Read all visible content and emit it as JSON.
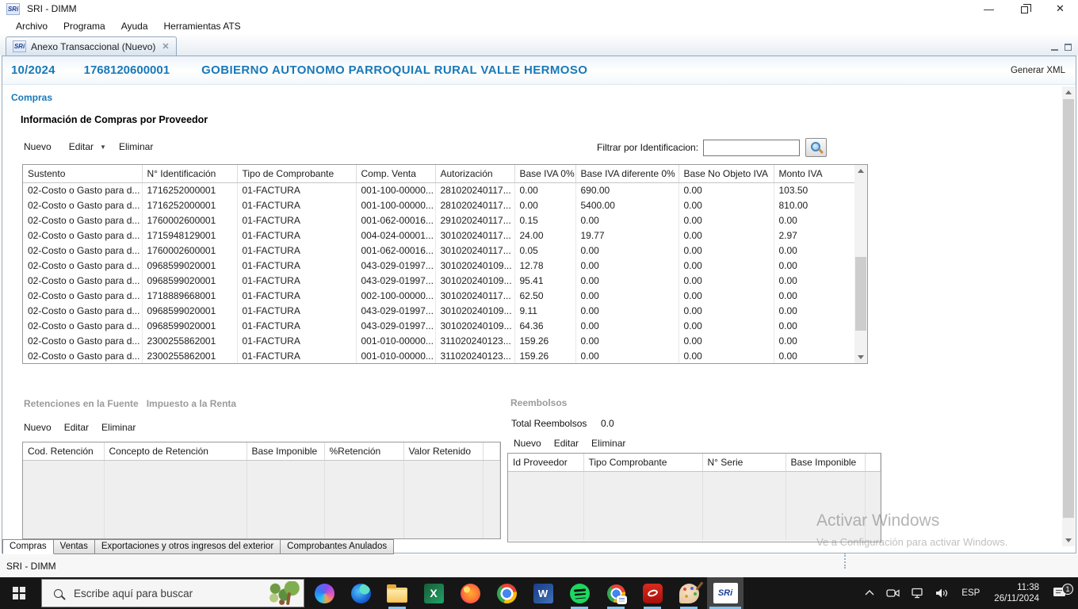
{
  "brand": {
    "logo_text": "SRi"
  },
  "window": {
    "title": "SRI - DIMM",
    "menu": [
      "Archivo",
      "Programa",
      "Ayuda",
      "Herramientas ATS"
    ],
    "editor_tab": "Anexo Transaccional (Nuevo)"
  },
  "header": {
    "period": "10/2024",
    "ruc": "1768120600001",
    "taxpayer": "GOBIERNO AUTONOMO PARROQUIAL RURAL VALLE HERMOSO",
    "generate_button": "Generar XML"
  },
  "compras": {
    "section_label": "Compras",
    "panel_title": "Información de Compras por Proveedor",
    "toolbar": {
      "nuevo": "Nuevo",
      "editar": "Editar",
      "eliminar": "Eliminar"
    },
    "filter_label": "Filtrar por Identificacion:",
    "filter_value": "",
    "table": {
      "columns": [
        "Sustento",
        "N° Identificación",
        "Tipo de Comprobante",
        "Comp. Venta",
        "Autorización",
        "Base IVA 0%",
        "Base IVA diferente 0%",
        "Base No Objeto IVA",
        "Monto IVA"
      ],
      "rows": [
        [
          "02-Costo o Gasto para d...",
          "1716252000001",
          "01-FACTURA",
          "001-100-00000...",
          "281020240117...",
          "0.00",
          "690.00",
          "0.00",
          "103.50"
        ],
        [
          "02-Costo o Gasto para d...",
          "1716252000001",
          "01-FACTURA",
          "001-100-00000...",
          "281020240117...",
          "0.00",
          "5400.00",
          "0.00",
          "810.00"
        ],
        [
          "02-Costo o Gasto para d...",
          "1760002600001",
          "01-FACTURA",
          "001-062-00016...",
          "291020240117...",
          "0.15",
          "0.00",
          "0.00",
          "0.00"
        ],
        [
          "02-Costo o Gasto para d...",
          "1715948129001",
          "01-FACTURA",
          "004-024-00001...",
          "301020240117...",
          "24.00",
          "19.77",
          "0.00",
          "2.97"
        ],
        [
          "02-Costo o Gasto para d...",
          "1760002600001",
          "01-FACTURA",
          "001-062-00016...",
          "301020240117...",
          "0.05",
          "0.00",
          "0.00",
          "0.00"
        ],
        [
          "02-Costo o Gasto para d...",
          "0968599020001",
          "01-FACTURA",
          "043-029-01997...",
          "301020240109...",
          "12.78",
          "0.00",
          "0.00",
          "0.00"
        ],
        [
          "02-Costo o Gasto para d...",
          "0968599020001",
          "01-FACTURA",
          "043-029-01997...",
          "301020240109...",
          "95.41",
          "0.00",
          "0.00",
          "0.00"
        ],
        [
          "02-Costo o Gasto para d...",
          "1718889668001",
          "01-FACTURA",
          "002-100-00000...",
          "301020240117...",
          "62.50",
          "0.00",
          "0.00",
          "0.00"
        ],
        [
          "02-Costo o Gasto para d...",
          "0968599020001",
          "01-FACTURA",
          "043-029-01997...",
          "301020240109...",
          "9.11",
          "0.00",
          "0.00",
          "0.00"
        ],
        [
          "02-Costo o Gasto para d...",
          "0968599020001",
          "01-FACTURA",
          "043-029-01997...",
          "301020240109...",
          "64.36",
          "0.00",
          "0.00",
          "0.00"
        ],
        [
          "02-Costo o Gasto para d...",
          "2300255862001",
          "01-FACTURA",
          "001-010-00000...",
          "311020240123...",
          "159.26",
          "0.00",
          "0.00",
          "0.00"
        ],
        [
          "02-Costo o Gasto para d...",
          "2300255862001",
          "01-FACTURA",
          "001-010-00000...",
          "311020240123...",
          "159.26",
          "0.00",
          "0.00",
          "0.00"
        ]
      ]
    }
  },
  "retenciones": {
    "title_left": "Retenciones en la Fuente",
    "title_right": "Impuesto a la Renta",
    "toolbar": {
      "nuevo": "Nuevo",
      "editar": "Editar",
      "eliminar": "Eliminar"
    },
    "table": {
      "columns": [
        "Cod. Retención",
        "Concepto de Retención",
        "Base Imponible",
        "%Retención",
        "Valor Retenido"
      ]
    }
  },
  "reembolsos": {
    "title": "Reembolsos",
    "total_label": "Total Reembolsos",
    "total_value": "0.0",
    "toolbar": {
      "nuevo": "Nuevo",
      "editar": "Editar",
      "eliminar": "Eliminar"
    },
    "table": {
      "columns": [
        "Id Proveedor",
        "Tipo Comprobante",
        "N° Serie",
        "Base Imponible"
      ]
    }
  },
  "bottom_tabs": {
    "tabs": [
      "Compras",
      "Ventas",
      "Exportaciones y otros ingresos del exterior",
      "Comprobantes Anulados"
    ],
    "active": "Compras"
  },
  "status_bar": {
    "text": "SRI - DIMM"
  },
  "watermark": {
    "line1": "Activar Windows",
    "line2": "Ve a Configuración para activar Windows."
  },
  "taskbar": {
    "search_placeholder": "Escribe aquí para buscar",
    "icons": [
      "copilot",
      "edge",
      "file-explorer",
      "excel",
      "firefox",
      "chrome",
      "word",
      "spotify",
      "chrome-profile",
      "acrobat-reader",
      "paint",
      "sri-dimm"
    ],
    "tray": {
      "language": "ESP",
      "time": "11:38",
      "date": "26/11/2024",
      "notification_count": "1"
    }
  },
  "colors": {
    "accent_blue": "#1879b8",
    "frame_border": "#93a9bd",
    "disabled_section_text": "#9b9b9b",
    "taskbar_bg": "#161616",
    "running_indicator": "#7fc4ee"
  }
}
